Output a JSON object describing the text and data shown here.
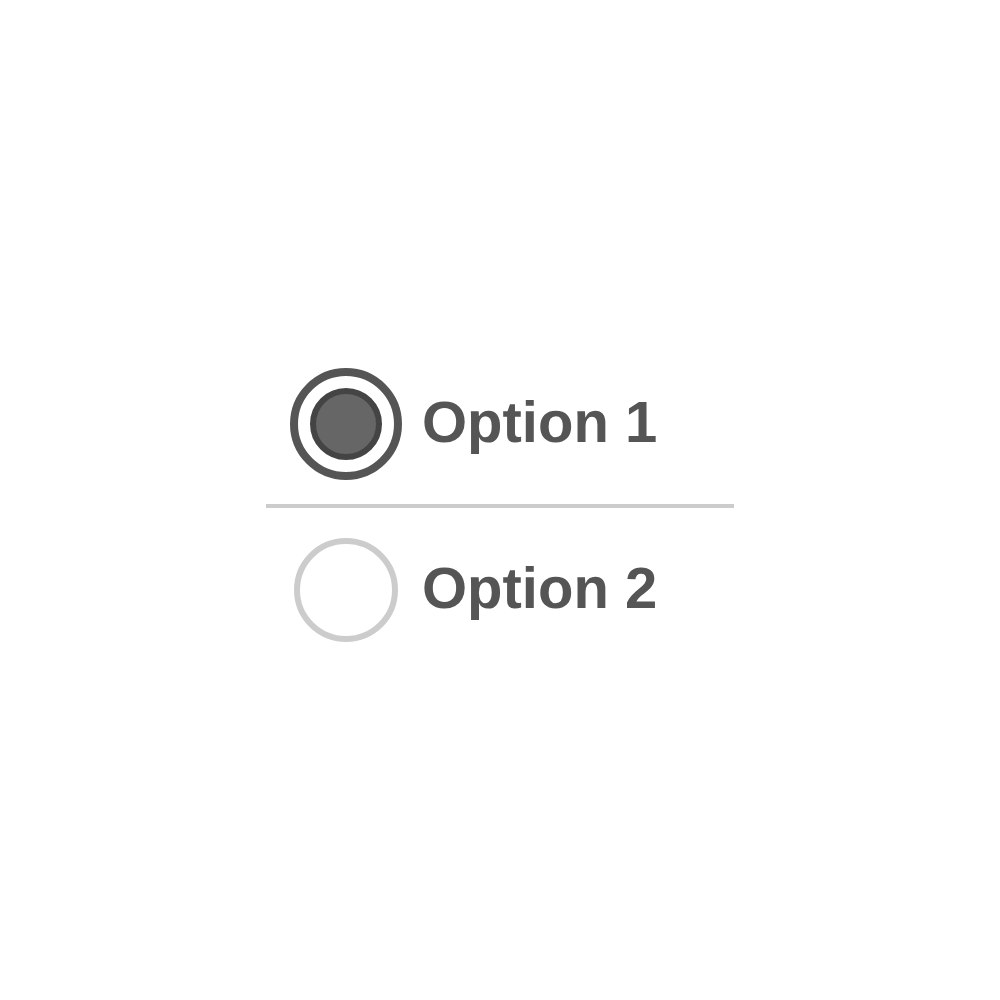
{
  "options": [
    {
      "label": "Option 1",
      "selected": true
    },
    {
      "label": "Option 2",
      "selected": false
    }
  ]
}
